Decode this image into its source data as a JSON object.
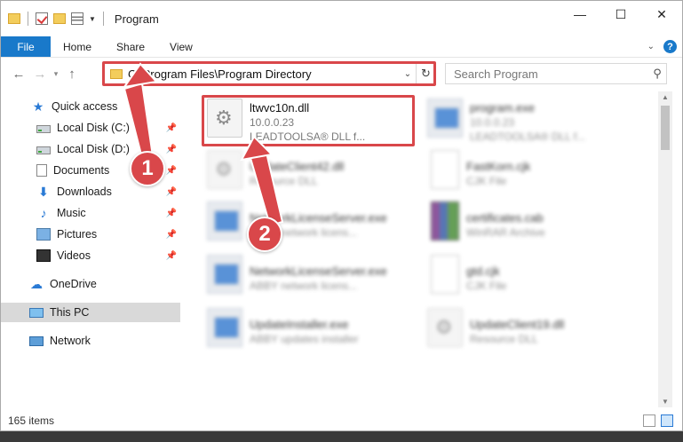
{
  "window": {
    "title": "Program",
    "minimize_glyph": "—",
    "maximize_glyph": "☐",
    "close_glyph": "✕"
  },
  "menu": {
    "file": "File",
    "home": "Home",
    "share": "Share",
    "view": "View"
  },
  "address": {
    "path": "C:\\Program Files\\Program Directory",
    "search_placeholder": "Search Program"
  },
  "sidebar": {
    "items": [
      {
        "label": "Quick access",
        "icon": "star-icon"
      },
      {
        "label": "Local Disk (C:)",
        "icon": "disk-icon"
      },
      {
        "label": "Local Disk (D:)",
        "icon": "disk-icon"
      },
      {
        "label": "Documents",
        "icon": "documents-icon"
      },
      {
        "label": "Downloads",
        "icon": "downloads-icon"
      },
      {
        "label": "Music",
        "icon": "music-icon"
      },
      {
        "label": "Pictures",
        "icon": "pictures-icon"
      },
      {
        "label": "Videos",
        "icon": "videos-icon"
      },
      {
        "label": "OneDrive",
        "icon": "cloud-icon"
      },
      {
        "label": "This PC",
        "icon": "computer-icon"
      },
      {
        "label": "Network",
        "icon": "network-icon"
      }
    ]
  },
  "files": [
    {
      "name": "ltwvc10n.dll",
      "line2": "10.0.0.23",
      "line3": "LEADTOOLSA® DLL f...",
      "icon": "dll-file-icon"
    },
    {
      "name": "program.exe",
      "line2": "10.0.0.23",
      "line3": "LEADTOOLSA® DLL f...",
      "icon": "exe-file-icon"
    },
    {
      "name": "UpdateClient42.dll",
      "line2": "Resource DLL",
      "icon": "dll-file-icon"
    },
    {
      "name": "FastKorn.cjk",
      "line2": "CJK File",
      "icon": "cjk-file-icon"
    },
    {
      "name": "NetworkLicenseServer.exe",
      "line2": "ABBY network licens...",
      "icon": "exe-file-icon"
    },
    {
      "name": "certificates.cab",
      "line2": "WinRAR Archive",
      "icon": "rar-file-icon"
    },
    {
      "name": "NetworkLicenseServer.exe",
      "line2": "ABBY network licens...",
      "icon": "exe-file-icon"
    },
    {
      "name": "gtd.cjk",
      "line2": "CJK File",
      "icon": "cjk-file-icon"
    },
    {
      "name": "UpdateInstaller.exe",
      "line2": "ABBY updates installer",
      "icon": "exe-file-icon"
    },
    {
      "name": "UpdateClient19.dll",
      "line2": "Resource DLL",
      "icon": "dll-file-icon"
    }
  ],
  "status": {
    "items_count": "165 items"
  },
  "callouts": {
    "one": "1",
    "two": "2"
  },
  "colors": {
    "accent": "#1979ca",
    "highlight": "#d9474a"
  }
}
